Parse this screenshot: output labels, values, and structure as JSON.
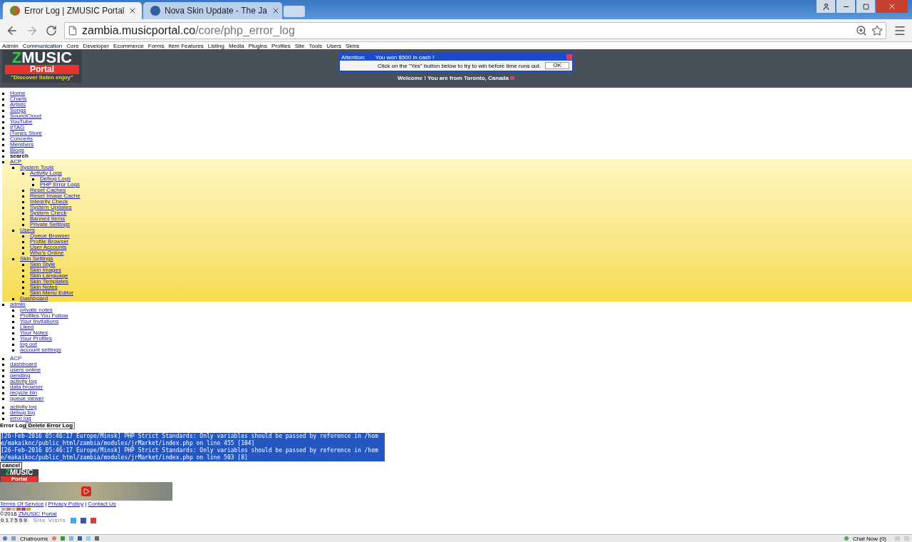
{
  "browser": {
    "tabs": [
      {
        "title": "Error Log | ZMUSIC Portal",
        "selected": true
      },
      {
        "title": "Nova Skin Update - The Ja",
        "selected": false
      }
    ],
    "url_host": "zambia.musicportal.co",
    "url_path": "/core/php_error_log"
  },
  "top_menu": [
    "Admin",
    "Communication",
    "Core",
    "Developer",
    "Ecommerce",
    "Forms",
    "Item Features",
    "Listing",
    "Media",
    "Plugins",
    "Profiles",
    "Site",
    "Tools",
    "Users",
    "Skins"
  ],
  "header": {
    "logo": {
      "first": "Z",
      "rest": "MUSIC",
      "portal": "Portal",
      "tagline": "\"Discover listen enjoy\""
    },
    "ad": {
      "title": "Attention:",
      "headline": "You won $500 in cash !",
      "message": "Click on the \"Yes\" button below to try to win before time runs out.",
      "button": "OK"
    },
    "welcome": "Welcome ! You are from Toronto, Canada"
  },
  "nav": [
    {
      "label": "Home",
      "kind": "link",
      "highlighted": false
    },
    {
      "label": "Charts",
      "kind": "link",
      "highlighted": false
    },
    {
      "label": "Artists",
      "kind": "link",
      "highlighted": false
    },
    {
      "label": "Songs",
      "kind": "link",
      "highlighted": false
    },
    {
      "label": "SoundCloud",
      "kind": "link",
      "highlighted": false
    },
    {
      "label": "YouTube",
      "kind": "link",
      "highlighted": false
    },
    {
      "label": "#TAG",
      "kind": "link",
      "highlighted": false
    },
    {
      "label": "iTunes Store",
      "kind": "link",
      "highlighted": false
    },
    {
      "label": "Concerts",
      "kind": "link",
      "highlighted": false
    },
    {
      "label": "Members",
      "kind": "link",
      "highlighted": false
    },
    {
      "label": "Blogs",
      "kind": "link",
      "highlighted": false
    },
    {
      "label": "search",
      "kind": "text",
      "highlighted": false
    },
    {
      "label": "ACP",
      "kind": "link",
      "highlighted": true,
      "children": [
        {
          "label": "System Tools",
          "kind": "link",
          "children": [
            {
              "label": "Activity Logs",
              "kind": "link",
              "children": [
                {
                  "label": "Debug Logs",
                  "kind": "link"
                },
                {
                  "label": "PHP Error Logs",
                  "kind": "link"
                }
              ]
            },
            {
              "label": "Reset Caches",
              "kind": "link"
            },
            {
              "label": "Reset Image Cache",
              "kind": "link"
            },
            {
              "label": "Integrity Check",
              "kind": "link"
            },
            {
              "label": "System Updates",
              "kind": "link"
            },
            {
              "label": "System Check",
              "kind": "link"
            },
            {
              "label": "Banned Items",
              "kind": "link"
            },
            {
              "label": "Private Settings",
              "kind": "link"
            }
          ]
        },
        {
          "label": "Users",
          "kind": "link",
          "children": [
            {
              "label": "Queue Browser",
              "kind": "link"
            },
            {
              "label": "Profile Browser",
              "kind": "link"
            },
            {
              "label": "User Accounts",
              "kind": "link"
            },
            {
              "label": "Who's Online",
              "kind": "link"
            }
          ]
        },
        {
          "label": "Skin Settings",
          "kind": "link",
          "children": [
            {
              "label": "Skin Style",
              "kind": "link"
            },
            {
              "label": "Skin Images",
              "kind": "link"
            },
            {
              "label": "Skin Language",
              "kind": "link"
            },
            {
              "label": "Skin Templates",
              "kind": "link"
            },
            {
              "label": "Skin Notes",
              "kind": "link"
            },
            {
              "label": "Skin Menu Editor",
              "kind": "link"
            }
          ]
        },
        {
          "label": "Dashboard",
          "kind": "link"
        }
      ]
    },
    {
      "label": "admin",
      "kind": "link",
      "highlighted": false,
      "children": [
        {
          "label": "private notes",
          "kind": "link"
        },
        {
          "label": "Profiles You Follow",
          "kind": "link"
        },
        {
          "label": "Your Invitations",
          "kind": "link"
        },
        {
          "label": "Liked",
          "kind": "link"
        },
        {
          "label": "Your Notes",
          "kind": "link"
        },
        {
          "label": "Your Profiles",
          "kind": "link"
        },
        {
          "label": "log out",
          "kind": "link"
        },
        {
          "label": "account settings",
          "kind": "link"
        }
      ]
    }
  ],
  "acp_links": [
    {
      "label": "ACP",
      "kind": "text"
    },
    {
      "label": "dashboard",
      "kind": "link"
    },
    {
      "label": "users online",
      "kind": "link"
    },
    {
      "label": "pending",
      "kind": "link"
    },
    {
      "label": "activity log",
      "kind": "link"
    },
    {
      "label": "data browser",
      "kind": "link"
    },
    {
      "label": "recycle bin",
      "kind": "link"
    },
    {
      "label": "queue viewer",
      "kind": "link"
    }
  ],
  "log_links": [
    "activity log",
    "debug log",
    "error log"
  ],
  "error_log": {
    "label": "Error Log",
    "delete_button": "Delete Error Log",
    "lines": [
      "[26-Feb-2016 05:46:17 Europe/Minsk] PHP Strict Standards: Only variables should be passed by reference in /home/makaikoc/public_html/zambia/modules/jrMarket/index.php on line 455 [104]",
      "[26-Feb-2016 05:46:17 Europe/Minsk] PHP Strict Standards: Only variables should be passed by reference in /home/makaikoc/public_html/zambia/modules/jrMarket/index.php on line 503 [8]"
    ],
    "cancel_button": "cancel"
  },
  "footer": {
    "logo": {
      "first": "Z",
      "rest": "MUSIC",
      "portal": "Portal"
    },
    "links": [
      "Terms Of Service",
      "Privacy Policy",
      "Contact Us"
    ],
    "separator": "|",
    "copyright": "©2016",
    "site_link": "ZMUSIC Portal",
    "counter": "017599",
    "counter_label": "Site Visits"
  },
  "taskbar": {
    "chatrooms": "Chatrooms",
    "chat_now": "Chat Now (0)"
  }
}
